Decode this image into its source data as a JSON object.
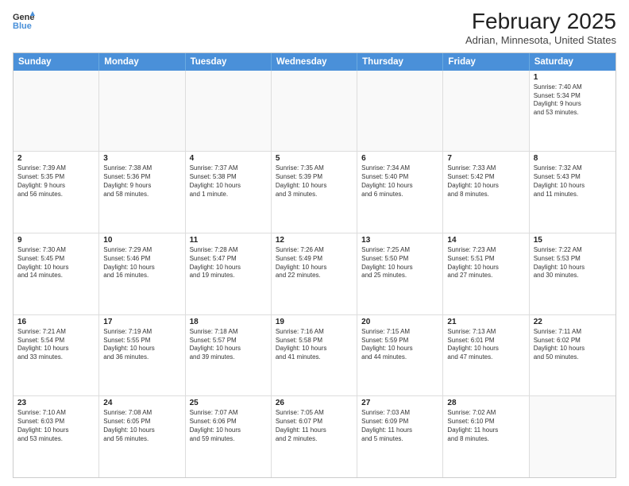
{
  "header": {
    "logo_line1": "General",
    "logo_line2": "Blue",
    "month": "February 2025",
    "location": "Adrian, Minnesota, United States"
  },
  "days_of_week": [
    "Sunday",
    "Monday",
    "Tuesday",
    "Wednesday",
    "Thursday",
    "Friday",
    "Saturday"
  ],
  "weeks": [
    [
      {
        "day": "",
        "empty": true
      },
      {
        "day": "",
        "empty": true
      },
      {
        "day": "",
        "empty": true
      },
      {
        "day": "",
        "empty": true
      },
      {
        "day": "",
        "empty": true
      },
      {
        "day": "",
        "empty": true
      },
      {
        "day": "1",
        "info": "Sunrise: 7:40 AM\nSunset: 5:34 PM\nDaylight: 9 hours\nand 53 minutes."
      }
    ],
    [
      {
        "day": "2",
        "info": "Sunrise: 7:39 AM\nSunset: 5:35 PM\nDaylight: 9 hours\nand 56 minutes."
      },
      {
        "day": "3",
        "info": "Sunrise: 7:38 AM\nSunset: 5:36 PM\nDaylight: 9 hours\nand 58 minutes."
      },
      {
        "day": "4",
        "info": "Sunrise: 7:37 AM\nSunset: 5:38 PM\nDaylight: 10 hours\nand 1 minute."
      },
      {
        "day": "5",
        "info": "Sunrise: 7:35 AM\nSunset: 5:39 PM\nDaylight: 10 hours\nand 3 minutes."
      },
      {
        "day": "6",
        "info": "Sunrise: 7:34 AM\nSunset: 5:40 PM\nDaylight: 10 hours\nand 6 minutes."
      },
      {
        "day": "7",
        "info": "Sunrise: 7:33 AM\nSunset: 5:42 PM\nDaylight: 10 hours\nand 8 minutes."
      },
      {
        "day": "8",
        "info": "Sunrise: 7:32 AM\nSunset: 5:43 PM\nDaylight: 10 hours\nand 11 minutes."
      }
    ],
    [
      {
        "day": "9",
        "info": "Sunrise: 7:30 AM\nSunset: 5:45 PM\nDaylight: 10 hours\nand 14 minutes."
      },
      {
        "day": "10",
        "info": "Sunrise: 7:29 AM\nSunset: 5:46 PM\nDaylight: 10 hours\nand 16 minutes."
      },
      {
        "day": "11",
        "info": "Sunrise: 7:28 AM\nSunset: 5:47 PM\nDaylight: 10 hours\nand 19 minutes."
      },
      {
        "day": "12",
        "info": "Sunrise: 7:26 AM\nSunset: 5:49 PM\nDaylight: 10 hours\nand 22 minutes."
      },
      {
        "day": "13",
        "info": "Sunrise: 7:25 AM\nSunset: 5:50 PM\nDaylight: 10 hours\nand 25 minutes."
      },
      {
        "day": "14",
        "info": "Sunrise: 7:23 AM\nSunset: 5:51 PM\nDaylight: 10 hours\nand 27 minutes."
      },
      {
        "day": "15",
        "info": "Sunrise: 7:22 AM\nSunset: 5:53 PM\nDaylight: 10 hours\nand 30 minutes."
      }
    ],
    [
      {
        "day": "16",
        "info": "Sunrise: 7:21 AM\nSunset: 5:54 PM\nDaylight: 10 hours\nand 33 minutes."
      },
      {
        "day": "17",
        "info": "Sunrise: 7:19 AM\nSunset: 5:55 PM\nDaylight: 10 hours\nand 36 minutes."
      },
      {
        "day": "18",
        "info": "Sunrise: 7:18 AM\nSunset: 5:57 PM\nDaylight: 10 hours\nand 39 minutes."
      },
      {
        "day": "19",
        "info": "Sunrise: 7:16 AM\nSunset: 5:58 PM\nDaylight: 10 hours\nand 41 minutes."
      },
      {
        "day": "20",
        "info": "Sunrise: 7:15 AM\nSunset: 5:59 PM\nDaylight: 10 hours\nand 44 minutes."
      },
      {
        "day": "21",
        "info": "Sunrise: 7:13 AM\nSunset: 6:01 PM\nDaylight: 10 hours\nand 47 minutes."
      },
      {
        "day": "22",
        "info": "Sunrise: 7:11 AM\nSunset: 6:02 PM\nDaylight: 10 hours\nand 50 minutes."
      }
    ],
    [
      {
        "day": "23",
        "info": "Sunrise: 7:10 AM\nSunset: 6:03 PM\nDaylight: 10 hours\nand 53 minutes."
      },
      {
        "day": "24",
        "info": "Sunrise: 7:08 AM\nSunset: 6:05 PM\nDaylight: 10 hours\nand 56 minutes."
      },
      {
        "day": "25",
        "info": "Sunrise: 7:07 AM\nSunset: 6:06 PM\nDaylight: 10 hours\nand 59 minutes."
      },
      {
        "day": "26",
        "info": "Sunrise: 7:05 AM\nSunset: 6:07 PM\nDaylight: 11 hours\nand 2 minutes."
      },
      {
        "day": "27",
        "info": "Sunrise: 7:03 AM\nSunset: 6:09 PM\nDaylight: 11 hours\nand 5 minutes."
      },
      {
        "day": "28",
        "info": "Sunrise: 7:02 AM\nSunset: 6:10 PM\nDaylight: 11 hours\nand 8 minutes."
      },
      {
        "day": "",
        "empty": true
      }
    ]
  ]
}
